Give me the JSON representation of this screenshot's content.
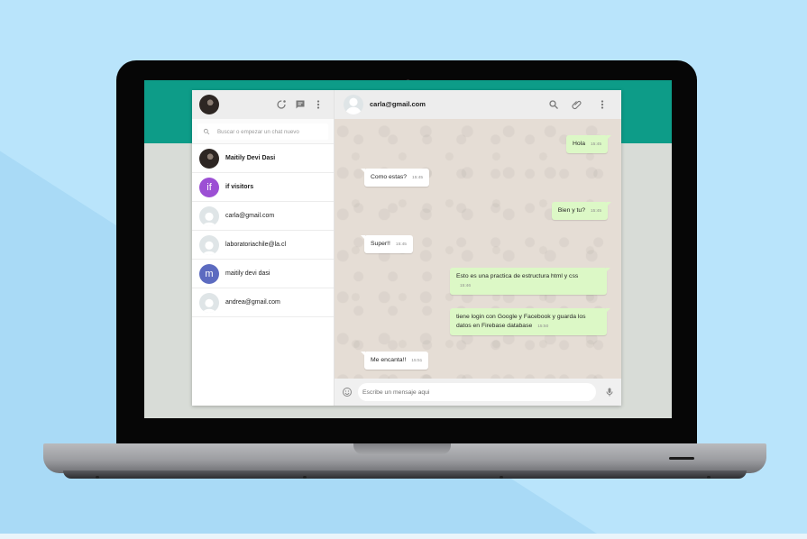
{
  "sidebar": {
    "search_placeholder": "Buscar o empezar un chat nuevo",
    "contacts": [
      {
        "name": "Maitily Devi Dasi",
        "avatar": "photo",
        "bold": true
      },
      {
        "name": "if visitors",
        "avatar": "letter",
        "letter": "if",
        "color": "#9c4fd4",
        "bold": true
      },
      {
        "name": "carla@gmail.com",
        "avatar": "default",
        "bold": false
      },
      {
        "name": "laboratoriachile@la.cl",
        "avatar": "default",
        "bold": false
      },
      {
        "name": "maitily devi dasi",
        "avatar": "letter",
        "letter": "m",
        "color": "#5c6bc0",
        "bold": false
      },
      {
        "name": "andrea@gmail.com",
        "avatar": "default",
        "bold": false
      }
    ]
  },
  "chat": {
    "title": "carla@gmail.com",
    "messages": [
      {
        "dir": "out",
        "text": "Hola",
        "time": "15:45"
      },
      {
        "dir": "in",
        "text": "Como estas?",
        "time": "15:45"
      },
      {
        "dir": "out",
        "text": "Bien y tu?",
        "time": "15:45"
      },
      {
        "dir": "in",
        "text": "Super!!",
        "time": "15:45"
      },
      {
        "dir": "out",
        "text": "Esto es una practica de estructura html y css",
        "time": "15:46"
      },
      {
        "dir": "out",
        "text": "tiene login con Google y Facebook y guarda los datos en Firebase database",
        "time": "15:50"
      },
      {
        "dir": "in",
        "text": "Me encanta!!",
        "time": "15:51"
      }
    ],
    "input_placeholder": "Escribe un mensaje aqui"
  },
  "colors": {
    "header_green": "#0d9c88",
    "outgoing_bubble": "#dcf8c6",
    "incoming_bubble": "#ffffff",
    "chat_background": "#e5ddd5"
  },
  "icons": {
    "sidebar_header": [
      "status-icon",
      "new-chat-icon",
      "menu-icon"
    ],
    "chat_header": [
      "search-icon",
      "attach-icon",
      "menu-icon"
    ],
    "footer": [
      "emoji-icon",
      "microphone-icon"
    ]
  }
}
